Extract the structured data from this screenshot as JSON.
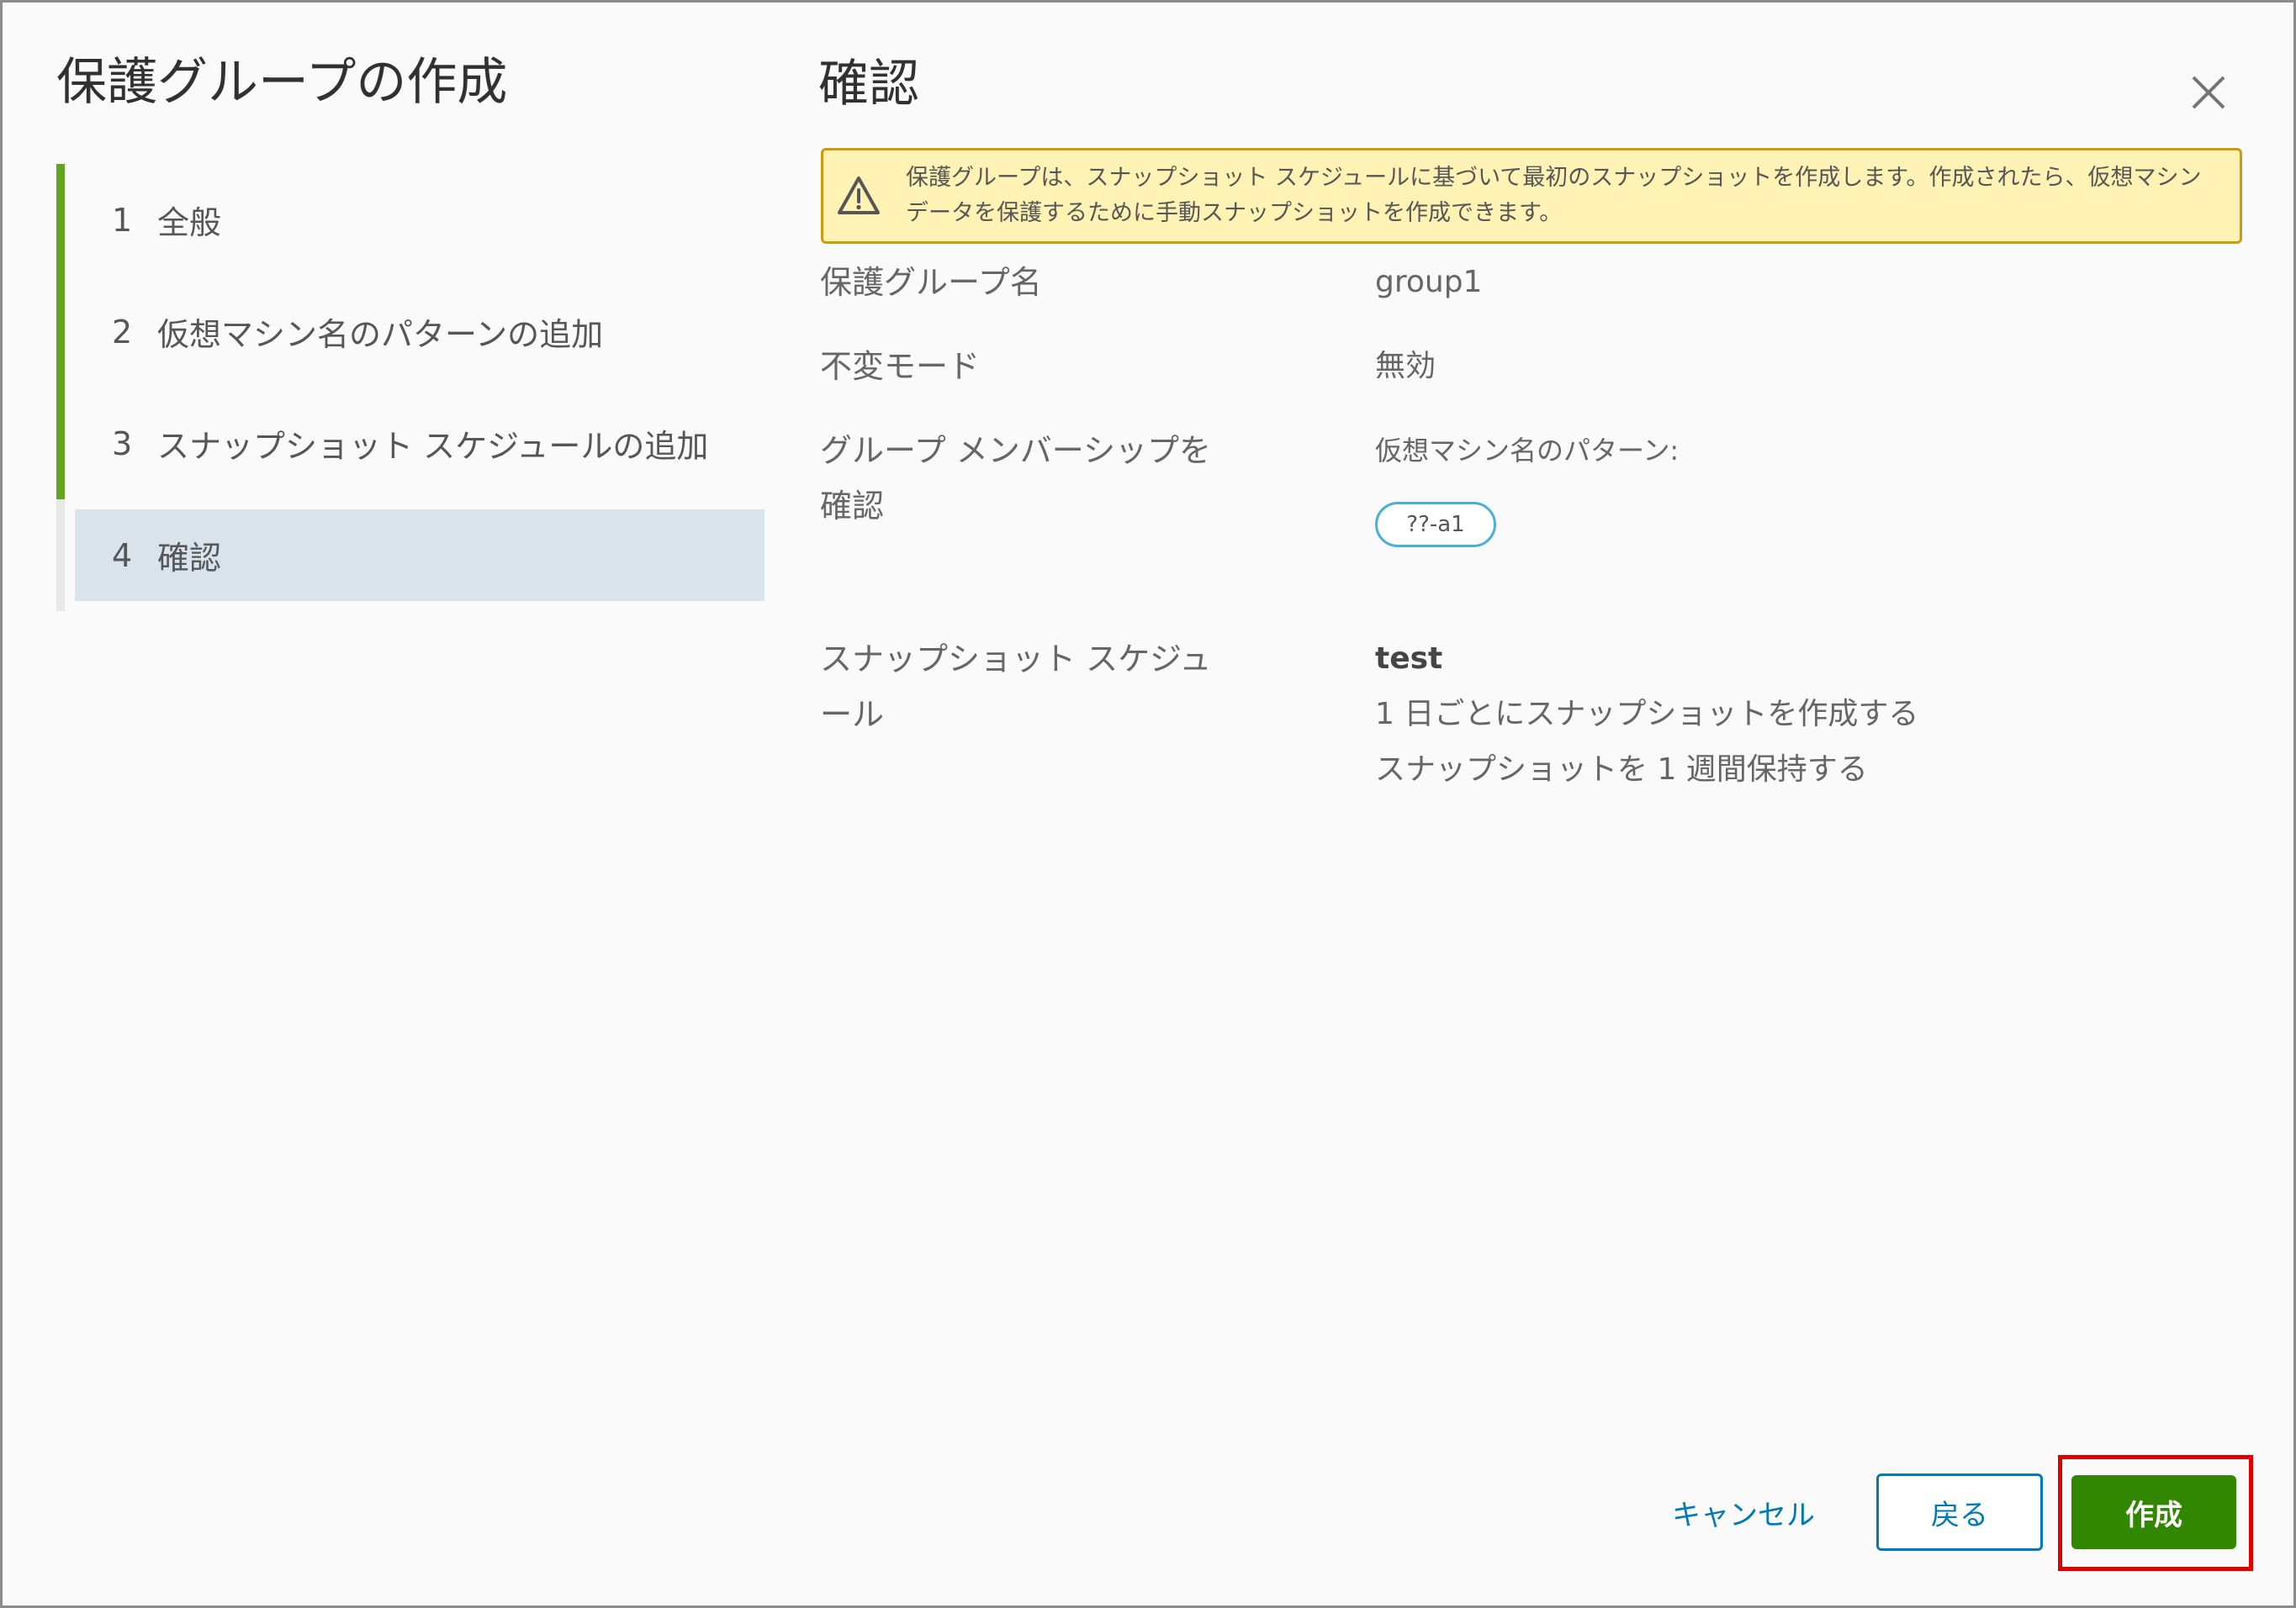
{
  "wizard": {
    "title": "保護グループの作成",
    "steps": [
      {
        "num": "1",
        "label": "全般"
      },
      {
        "num": "2",
        "label": "仮想マシン名のパターンの追加"
      },
      {
        "num": "3",
        "label": "スナップショット スケジュールの追加"
      },
      {
        "num": "4",
        "label": "確認"
      }
    ],
    "current_step": 4
  },
  "page": {
    "title": "確認",
    "alert": {
      "icon": "warning-triangle-icon",
      "text": "保護グループは、スナップショット スケジュールに基づいて最初のスナップショットを作成します。作成されたら、仮想マシン データを保護するために手動スナップショットを作成できます。"
    },
    "summary": {
      "group_name_label": "保護グループ名",
      "group_name_value": "group1",
      "immutable_label": "不変モード",
      "immutable_value": "無効",
      "membership_label": "グループ メンバーシップを確認",
      "membership_caption": "仮想マシン名のパターン:",
      "membership_pattern": "??-a1",
      "schedule_label": "スナップショット スケジュール",
      "schedule_name": "test",
      "schedule_frequency": "1 日ごとにスナップショットを作成する",
      "schedule_retention": "スナップショットを 1 週間保持する"
    }
  },
  "footer": {
    "cancel_label": "キャンセル",
    "back_label": "戻る",
    "create_label": "作成"
  },
  "colors": {
    "step_complete": "#62a420",
    "step_current_bg": "#d8e3ec",
    "alert_bg": "#fef3b5",
    "alert_border": "#d09b0b",
    "primary_link": "#0079b8",
    "create_button": "#318700",
    "callout_frame": "#e00000"
  }
}
